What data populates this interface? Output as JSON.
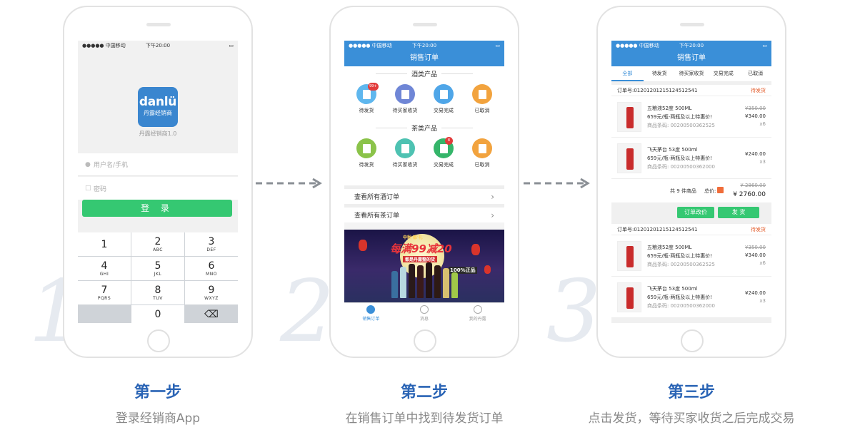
{
  "status": {
    "carrier": "●●●●● 中国移动",
    "time": "下午20:00",
    "battery": "▭"
  },
  "steps": [
    {
      "num": "1",
      "title": "第一步",
      "subtitle": "登录经销商App"
    },
    {
      "num": "2",
      "title": "第二步",
      "subtitle": "在销售订单中找到待发货订单"
    },
    {
      "num": "3",
      "title": "第三步",
      "subtitle": "点击发货，等待买家收货之后完成交易"
    }
  ],
  "login": {
    "logo_word": "danlü",
    "logo_cn": "丹露经销商",
    "version": "丹露经销商1.0",
    "username_placeholder": "用户名/手机",
    "password_placeholder": "密码",
    "login_button": "登 录",
    "keys": [
      {
        "n": "1",
        "l": ""
      },
      {
        "n": "2",
        "l": "ABC"
      },
      {
        "n": "3",
        "l": "DEF"
      },
      {
        "n": "4",
        "l": "GHI"
      },
      {
        "n": "5",
        "l": "JKL"
      },
      {
        "n": "6",
        "l": "MNO"
      },
      {
        "n": "7",
        "l": "PQRS"
      },
      {
        "n": "8",
        "l": "TUV"
      },
      {
        "n": "9",
        "l": "WXYZ"
      },
      {
        "n": "",
        "l": ""
      },
      {
        "n": "0",
        "l": ""
      },
      {
        "n": "⌫",
        "l": ""
      }
    ]
  },
  "orders": {
    "title": "销售订单",
    "wine_section": "酒类产品",
    "tea_section": "茶类产品",
    "wine_icons": [
      {
        "label": "待发货",
        "color": "#5fb7ee",
        "badge": "99+"
      },
      {
        "label": "待买家收货",
        "color": "#6f86d6",
        "badge": ""
      },
      {
        "label": "交易完成",
        "color": "#4fa6e8",
        "badge": ""
      },
      {
        "label": "已取消",
        "color": "#f2a33e",
        "badge": ""
      }
    ],
    "tea_icons": [
      {
        "label": "待发货",
        "color": "#8bc34a",
        "badge": ""
      },
      {
        "label": "待买家收货",
        "color": "#4ec2b2",
        "badge": ""
      },
      {
        "label": "交易完成",
        "color": "#35b56a",
        "badge": "8"
      },
      {
        "label": "已取消",
        "color": "#f2a33e",
        "badge": ""
      }
    ],
    "view_wine": "查看所有酒订单",
    "view_tea": "查看所有茶订单",
    "banner_top": "中秋'都'礼",
    "banner_main": "每满99减20",
    "banner_sub": "都是丹露整的货",
    "banner_corner": "100%正品",
    "tabs": [
      "销售订单",
      "消息",
      "我的丹露"
    ]
  },
  "detail": {
    "title": "销售订单",
    "tabs": [
      "全部",
      "待发货",
      "待买家收货",
      "交易完成",
      "已取消"
    ],
    "orders": [
      {
        "no": "订单号:01201201215124512541",
        "status": "待发货",
        "items": [
          {
            "name": "五粮液52度 500ML",
            "desc": "659元/瓶-两瓶及以上特惠价!",
            "code": "商品条码: 00200500362525",
            "old": "¥350.00",
            "price": "¥340.00",
            "qty": "x6"
          },
          {
            "name": "飞天茅台 53度 500ml",
            "desc": "659元/瓶-两瓶及以上特惠价!",
            "code": "商品条码: 00200500362000",
            "old": "",
            "price": "¥240.00",
            "qty": "x3"
          }
        ]
      },
      {
        "no": "订单号:01201201215124512541",
        "status": "待发货",
        "items": [
          {
            "name": "五粮液52度 500ML",
            "desc": "659元/瓶-两瓶及以上特惠价!",
            "code": "商品条码: 00200500362525",
            "old": "¥350.00",
            "price": "¥340.00",
            "qty": "x6"
          },
          {
            "name": "飞天茅台 53度 500ml",
            "desc": "659元/瓶-两瓶及以上特惠价!",
            "code": "商品条码: 00200500362000",
            "old": "",
            "price": "¥240.00",
            "qty": "x3"
          }
        ]
      }
    ],
    "count_label": "共 9 件商品",
    "total_label": "总价:",
    "total_old": "¥ 2860.00",
    "total_new": "¥ 2760.00",
    "btn_modify": "订单改价",
    "btn_ship": "发 货"
  }
}
